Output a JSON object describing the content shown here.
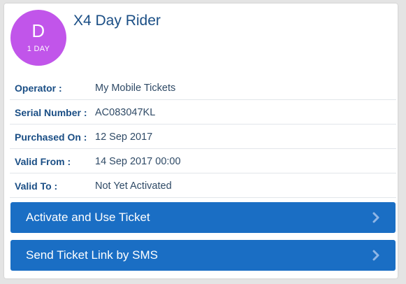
{
  "ticket": {
    "badge_letter": "D",
    "badge_subtitle": "1 DAY",
    "title": "X4 Day Rider",
    "badge_color": "#c155ea"
  },
  "details": [
    {
      "label": "Operator :",
      "value": "My Mobile Tickets"
    },
    {
      "label": "Serial Number :",
      "value": "AC083047KL"
    },
    {
      "label": "Purchased On :",
      "value": "12 Sep 2017"
    },
    {
      "label": "Valid From :",
      "value": "14 Sep 2017 00:00"
    },
    {
      "label": "Valid To :",
      "value": "Not Yet Activated"
    }
  ],
  "actions": {
    "activate_label": "Activate and Use Ticket",
    "sms_label": "Send Ticket Link by SMS",
    "button_color": "#1a6ec4",
    "icon": "chevron-right-icon"
  }
}
